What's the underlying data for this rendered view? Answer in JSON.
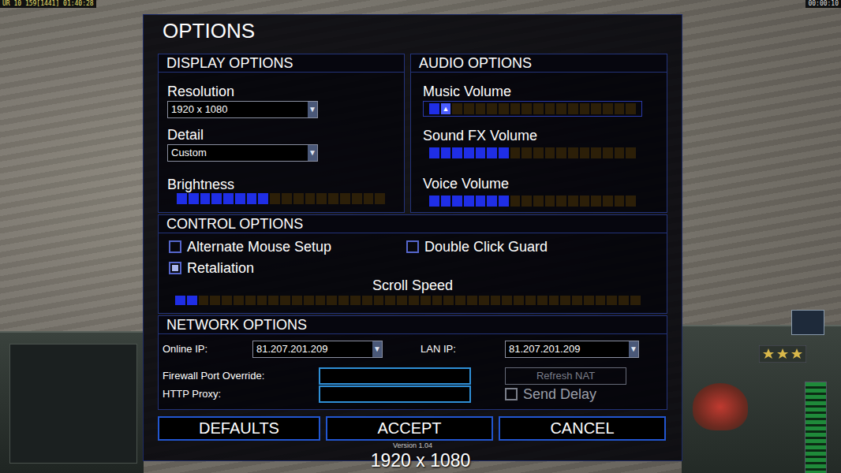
{
  "hud": {
    "top_left": "UR 10 159[1441] 01:40:28",
    "top_right": "00:00:10"
  },
  "dialog": {
    "title": "OPTIONS",
    "version": "Version 1.04"
  },
  "display": {
    "header": "DISPLAY OPTIONS",
    "dropdowns": [
      {
        "label": "Resolution",
        "value": "1920 x 1080",
        "arrow": "▼"
      },
      {
        "label": "Detail",
        "value": "Custom",
        "arrow": "▼"
      }
    ],
    "brightness": {
      "label": "Brightness",
      "level": 0.44
    }
  },
  "audio": {
    "header": "AUDIO OPTIONS",
    "sliders": [
      {
        "label": "Music Volume",
        "level": 0.11,
        "focused": true,
        "thumb": "▲"
      },
      {
        "label": "Sound FX Volume",
        "level": 0.39,
        "focused": false
      },
      {
        "label": "Voice Volume",
        "level": 0.39,
        "focused": false
      }
    ]
  },
  "controls": {
    "header": "CONTROL OPTIONS",
    "checkboxes": [
      {
        "label": "Alternate Mouse Setup",
        "checked": false
      },
      {
        "label": "Double Click Guard",
        "checked": false
      },
      {
        "label": "Retaliation",
        "checked": true
      }
    ],
    "scroll_speed": {
      "label": "Scroll Speed",
      "level": 0.05
    }
  },
  "network": {
    "header": "NETWORK OPTIONS",
    "online_ip": {
      "label": "Online IP:",
      "value": "81.207.201.209",
      "arrow": "▼"
    },
    "lan_ip": {
      "label": "LAN IP:",
      "value": "81.207.201.209",
      "arrow": "▼"
    },
    "fields": [
      {
        "label": "Firewall Port Override:",
        "value": ""
      },
      {
        "label": "HTTP Proxy:",
        "value": ""
      }
    ],
    "refresh_nat": {
      "label": "Refresh NAT",
      "disabled": true
    },
    "send_delay": {
      "label": "Send Delay",
      "checked": false,
      "disabled": true
    }
  },
  "buttons": [
    {
      "label": "DEFAULTS"
    },
    {
      "label": "ACCEPT"
    },
    {
      "label": "CANCEL"
    }
  ],
  "notice": "1920 x 1080"
}
